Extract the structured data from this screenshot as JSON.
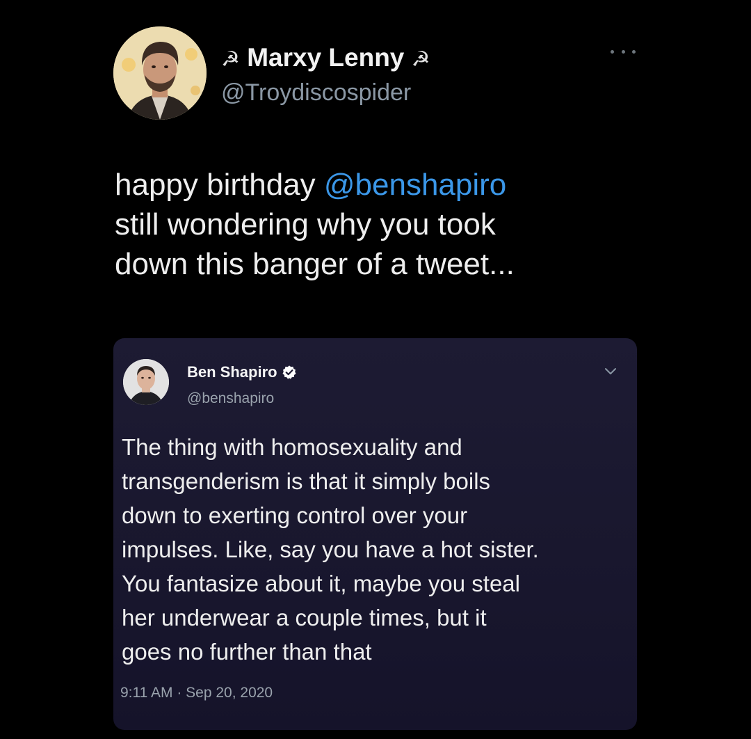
{
  "tweet": {
    "author": {
      "display_name": "Marxy Lenny",
      "name_symbol_left": "☭",
      "name_symbol_right": "☭",
      "handle": "@Troydiscospider",
      "avatar_icon": "user-avatar-photo"
    },
    "more_icon": "more-horizontal-icon",
    "text_lines": [
      {
        "before": "happy birthday ",
        "mention": "@benshapiro"
      },
      {
        "text": "still wondering why you took"
      },
      {
        "text": "down this banger of a tweet..."
      }
    ]
  },
  "quoted_tweet": {
    "author": {
      "display_name": "Ben Shapiro",
      "handle": "@benshapiro",
      "verified_icon": "verified-badge-icon",
      "avatar_icon": "user-avatar-photo"
    },
    "menu_icon": "chevron-down-icon",
    "body_lines": [
      "The thing with homosexuality and",
      "transgenderism is that it simply boils",
      "down to exerting control over your",
      "impulses. Like, say you have a hot sister.",
      "You fantasize about it, maybe you steal",
      "her underwear a couple times, but it",
      "goes no further than that"
    ],
    "time": "9:11 AM",
    "separator": " · ",
    "date": "Sep 20, 2020"
  },
  "colors": {
    "background": "#000000",
    "mention": "#3b97e8",
    "card_background": "#1b1930",
    "secondary_text": "#8b98a5",
    "verified_badge": "#ffffff"
  }
}
